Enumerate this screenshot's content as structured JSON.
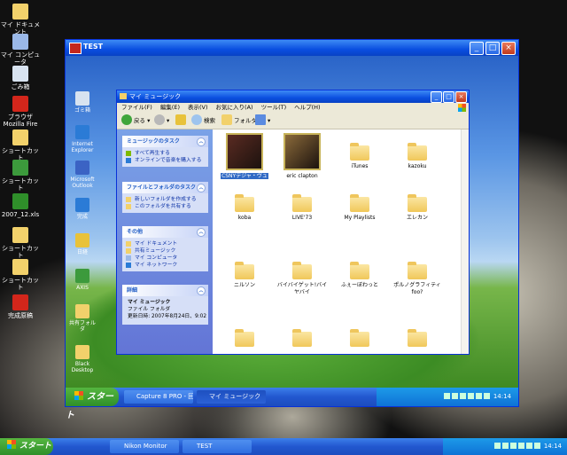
{
  "host_desktop": {
    "icons": [
      {
        "label": "マイ ドキュメント",
        "color": "#f2d16b"
      },
      {
        "label": "マイ コンピュータ",
        "color": "#9ab8e8"
      },
      {
        "label": "ごみ箱",
        "color": "#d8e3f0"
      },
      {
        "label": "ブラウザ Mozilla Fire",
        "color": "#d3261b"
      },
      {
        "label": "ショートカット",
        "color": "#f2d16b"
      },
      {
        "label": "ショートカット",
        "color": "#3c9a3c"
      },
      {
        "label": "2007_12.xls",
        "color": "#2f8f2a"
      },
      {
        "label": "ショートカット",
        "color": "#f2d16b"
      },
      {
        "label": "ショートカット",
        "color": "#f2d16b"
      },
      {
        "label": "完成原稿",
        "color": "#d3261b"
      }
    ]
  },
  "vm_window": {
    "title": "TEST",
    "desktop_icons": [
      {
        "label": "ゴミ箱",
        "color": "#d8e3f0"
      },
      {
        "label": "Internet Explorer",
        "color": "#2b7bd6"
      },
      {
        "label": "Microsoft Outlook",
        "color": "#3b63c4"
      },
      {
        "label": "完成",
        "color": "#2b7bd6"
      },
      {
        "label": "日経",
        "color": "#e8c23a"
      },
      {
        "label": "AXIS",
        "color": "#3c9a3c"
      },
      {
        "label": "共有フォルダ",
        "color": "#f2d16b"
      },
      {
        "label": "Black Desktop",
        "color": "#f2d16b"
      }
    ],
    "taskbar": {
      "start_label": "スタート",
      "tasks": [
        "Capture 8 PRO - 回...",
        "マイ ミュージック"
      ],
      "clock": "14:14"
    }
  },
  "explorer": {
    "title": "マイ ミュージック",
    "menu": [
      "ファイル(F)",
      "編集(E)",
      "表示(V)",
      "お気に入り(A)",
      "ツール(T)",
      "ヘルプ(H)"
    ],
    "toolbar": {
      "back": "戻る",
      "search": "検索",
      "folders": "フォルダ"
    },
    "tasks_panel": {
      "title": "ミュージックのタスク",
      "items": [
        "すべて再生する",
        "オンラインで音楽を購入する"
      ]
    },
    "file_tasks_panel": {
      "title": "ファイルとフォルダのタスク",
      "items": [
        "新しいフォルダを作成する",
        "このフォルダを共有する"
      ]
    },
    "other_panel": {
      "title": "その他",
      "items": [
        "マイ ドキュメント",
        "共有ミュージック",
        "マイ コンピュータ",
        "マイ ネットワーク"
      ]
    },
    "details_panel": {
      "title": "詳細",
      "name": "マイ ミュージック",
      "type": "ファイル フォルダ",
      "date": "更新日時: 2007年8月24日、9:02"
    },
    "items": [
      {
        "label": "CSNYデジャ・ヴュ",
        "kind": "album",
        "selected": true
      },
      {
        "label": "eric clapton",
        "kind": "album",
        "selected": false
      },
      {
        "label": "iTunes",
        "kind": "folder",
        "selected": false
      },
      {
        "label": "kazoku",
        "kind": "folder",
        "selected": false
      },
      {
        "label": "koba",
        "kind": "folder",
        "selected": false
      },
      {
        "label": "LIVE'73",
        "kind": "folder",
        "selected": false
      },
      {
        "label": "My Playlists",
        "kind": "folder",
        "selected": false
      },
      {
        "label": "エレカン",
        "kind": "folder",
        "selected": false
      },
      {
        "label": "ニルソン",
        "kind": "folder",
        "selected": false
      },
      {
        "label": "バイバイゲット!バイヤバイ",
        "kind": "folder",
        "selected": false
      },
      {
        "label": "ふぇーぼわっと",
        "kind": "folder",
        "selected": false
      },
      {
        "label": "ポルノグラフィティfoo?",
        "kind": "folder",
        "selected": false
      },
      {
        "label": "",
        "kind": "folder",
        "selected": false
      },
      {
        "label": "",
        "kind": "folder",
        "selected": false
      },
      {
        "label": "",
        "kind": "folder",
        "selected": false
      },
      {
        "label": "",
        "kind": "folder",
        "selected": false
      }
    ]
  },
  "host_taskbar": {
    "start_label": "スタート",
    "tasks": [
      "Nikon Monitor",
      "TEST"
    ],
    "clock": "14:14"
  }
}
